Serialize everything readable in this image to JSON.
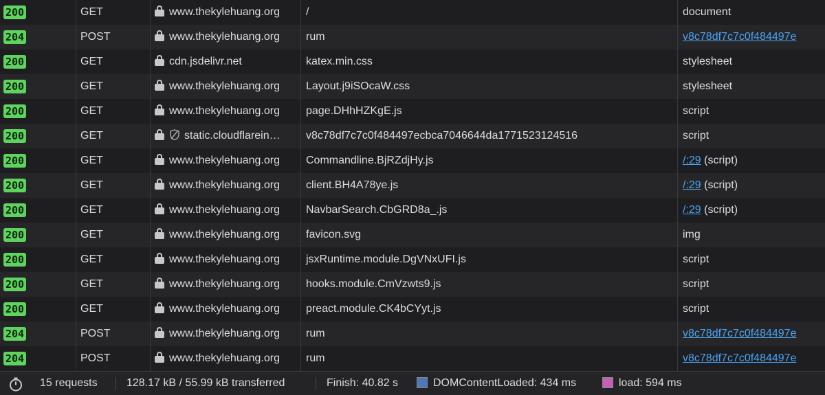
{
  "requests": [
    {
      "status": "200",
      "method": "GET",
      "secure_icon": "lock-icon",
      "domain": "www.thekylehuang.org",
      "file": "/",
      "initiator": "document",
      "initiator_link": "",
      "initiator_suffix": ""
    },
    {
      "status": "204",
      "method": "POST",
      "secure_icon": "lock-icon",
      "domain": "www.thekylehuang.org",
      "file": "rum",
      "initiator": "",
      "initiator_link": "v8c78df7c7c0f484497e",
      "initiator_suffix": ""
    },
    {
      "status": "200",
      "method": "GET",
      "secure_icon": "lock-icon",
      "domain": "cdn.jsdelivr.net",
      "file": "katex.min.css",
      "initiator": "stylesheet",
      "initiator_link": "",
      "initiator_suffix": ""
    },
    {
      "status": "200",
      "method": "GET",
      "secure_icon": "lock-icon",
      "domain": "www.thekylehuang.org",
      "file": "Layout.j9iSOcaW.css",
      "initiator": "stylesheet",
      "initiator_link": "",
      "initiator_suffix": ""
    },
    {
      "status": "200",
      "method": "GET",
      "secure_icon": "lock-icon",
      "domain": "www.thekylehuang.org",
      "file": "page.DHhHZKgE.js",
      "initiator": "script",
      "initiator_link": "",
      "initiator_suffix": ""
    },
    {
      "status": "200",
      "method": "GET",
      "secure_icon": "lock-tracker-icon",
      "domain": "static.cloudflarein…",
      "file": "v8c78df7c7c0f484497ecbca7046644da1771523124516",
      "initiator": "script",
      "initiator_link": "",
      "initiator_suffix": ""
    },
    {
      "status": "200",
      "method": "GET",
      "secure_icon": "lock-icon",
      "domain": "www.thekylehuang.org",
      "file": "Commandline.BjRZdjHy.js",
      "initiator": "",
      "initiator_link": "/:29",
      "initiator_suffix": " (script)"
    },
    {
      "status": "200",
      "method": "GET",
      "secure_icon": "lock-icon",
      "domain": "www.thekylehuang.org",
      "file": "client.BH4A78ye.js",
      "initiator": "",
      "initiator_link": "/:29",
      "initiator_suffix": " (script)"
    },
    {
      "status": "200",
      "method": "GET",
      "secure_icon": "lock-icon",
      "domain": "www.thekylehuang.org",
      "file": "NavbarSearch.CbGRD8a_.js",
      "initiator": "",
      "initiator_link": "/:29",
      "initiator_suffix": " (script)"
    },
    {
      "status": "200",
      "method": "GET",
      "secure_icon": "lock-icon",
      "domain": "www.thekylehuang.org",
      "file": "favicon.svg",
      "initiator": "img",
      "initiator_link": "",
      "initiator_suffix": ""
    },
    {
      "status": "200",
      "method": "GET",
      "secure_icon": "lock-icon",
      "domain": "www.thekylehuang.org",
      "file": "jsxRuntime.module.DgVNxUFI.js",
      "initiator": "script",
      "initiator_link": "",
      "initiator_suffix": ""
    },
    {
      "status": "200",
      "method": "GET",
      "secure_icon": "lock-icon",
      "domain": "www.thekylehuang.org",
      "file": "hooks.module.CmVzwts9.js",
      "initiator": "script",
      "initiator_link": "",
      "initiator_suffix": ""
    },
    {
      "status": "200",
      "method": "GET",
      "secure_icon": "lock-icon",
      "domain": "www.thekylehuang.org",
      "file": "preact.module.CK4bCYyt.js",
      "initiator": "script",
      "initiator_link": "",
      "initiator_suffix": ""
    },
    {
      "status": "204",
      "method": "POST",
      "secure_icon": "lock-icon",
      "domain": "www.thekylehuang.org",
      "file": "rum",
      "initiator": "",
      "initiator_link": "v8c78df7c7c0f484497e",
      "initiator_suffix": ""
    },
    {
      "status": "204",
      "method": "POST",
      "secure_icon": "lock-icon",
      "domain": "www.thekylehuang.org",
      "file": "rum",
      "initiator": "",
      "initiator_link": "v8c78df7c7c0f484497e",
      "initiator_suffix": ""
    }
  ],
  "footer": {
    "timer_icon": "stopwatch-icon",
    "requests": "15 requests",
    "transferred": "128.17 kB / 55.99 kB transferred",
    "finish": "Finish: 40.82 s",
    "dom_content_loaded": "DOMContentLoaded: 434 ms",
    "load": "load: 594 ms"
  },
  "colors": {
    "status_ok": "#5fd25f",
    "link": "#4aa3f5",
    "dom_swatch": "#4a78b8",
    "load_swatch": "#c85fb4"
  }
}
